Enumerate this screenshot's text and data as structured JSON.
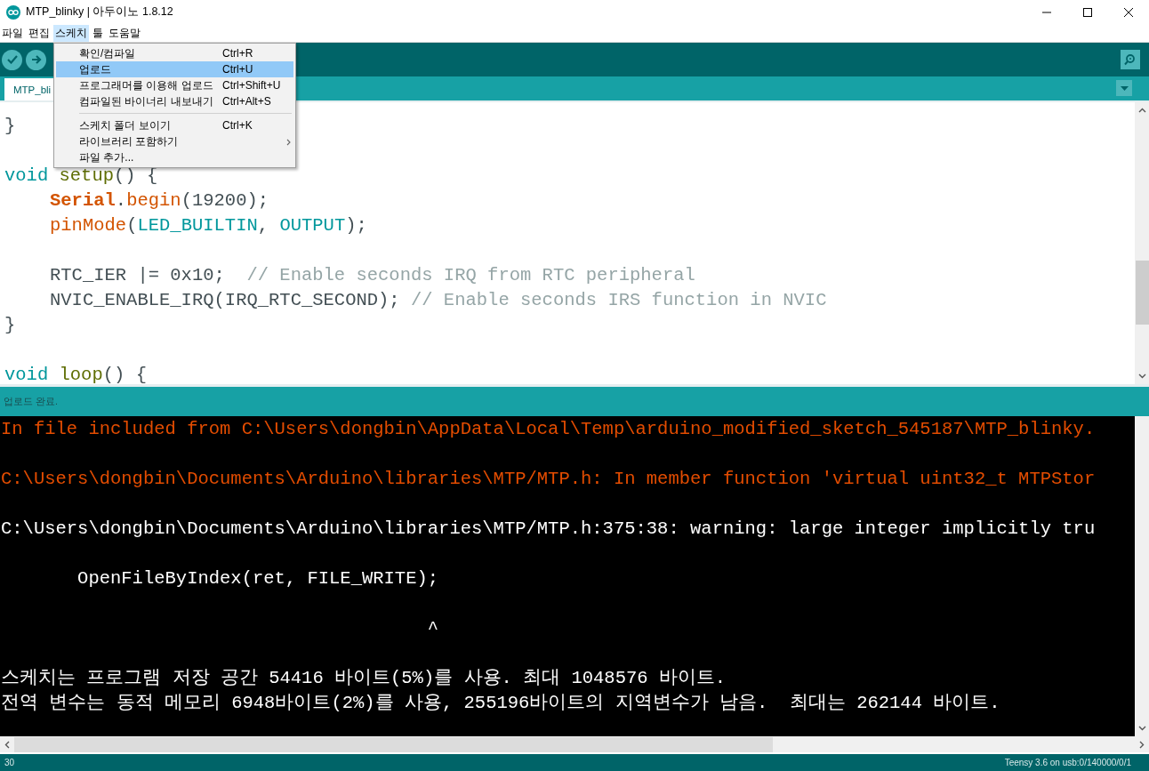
{
  "window": {
    "title": "MTP_blinky | 아두이노 1.8.12"
  },
  "menu_bar": [
    {
      "label": "파일",
      "selected": false
    },
    {
      "label": "편집",
      "selected": false
    },
    {
      "label": "스케치",
      "selected": true
    },
    {
      "label": "툴",
      "selected": false
    },
    {
      "label": "도움말",
      "selected": false
    }
  ],
  "menu": {
    "groups": [
      [
        {
          "kind": "item",
          "label": "확인/컴파일",
          "shortcut": "Ctrl+R",
          "selected": false
        },
        {
          "kind": "item",
          "label": "업로드",
          "shortcut": "Ctrl+U",
          "selected": true
        },
        {
          "kind": "item",
          "label": "프로그래머를 이용해 업로드",
          "shortcut": "Ctrl+Shift+U",
          "selected": false
        },
        {
          "kind": "item",
          "label": "컴파일된 바이너리 내보내기",
          "shortcut": "Ctrl+Alt+S",
          "selected": false
        }
      ],
      [
        {
          "kind": "item",
          "label": "스케치 폴더 보이기",
          "shortcut": "Ctrl+K",
          "selected": false
        },
        {
          "kind": "submenu",
          "label": "라이브러리 포함하기",
          "selected": false
        },
        {
          "kind": "item",
          "label": "파일 추가...",
          "selected": false
        }
      ]
    ]
  },
  "tabs": [
    {
      "label": "MTP_bli",
      "selected": true
    }
  ],
  "editor": {
    "lines": [
      {
        "kind": "code",
        "indented": false,
        "tokens": [
          {
            "kind": "plain",
            "text": "}"
          }
        ]
      },
      {
        "kind": "blank"
      },
      {
        "kind": "code",
        "indented": false,
        "tokens": [
          {
            "kind": "keyword",
            "text": "void "
          },
          {
            "kind": "function",
            "text": "setup"
          },
          {
            "kind": "plain",
            "text": "() {"
          }
        ]
      },
      {
        "kind": "code",
        "indented": true,
        "tokens": [
          {
            "kind": "class",
            "text": "Serial"
          },
          {
            "kind": "plain",
            "text": "."
          },
          {
            "kind": "method",
            "text": "begin"
          },
          {
            "kind": "plain",
            "text": "(19200);"
          }
        ]
      },
      {
        "kind": "code",
        "indented": true,
        "tokens": [
          {
            "kind": "method",
            "text": "pinMode"
          },
          {
            "kind": "plain",
            "text": "("
          },
          {
            "kind": "constant",
            "text": "LED_BUILTIN"
          },
          {
            "kind": "plain",
            "text": ", "
          },
          {
            "kind": "constant",
            "text": "OUTPUT"
          },
          {
            "kind": "plain",
            "text": ");"
          }
        ]
      },
      {
        "kind": "blank"
      },
      {
        "kind": "code",
        "indented": true,
        "tokens": [
          {
            "kind": "plain",
            "text": "RTC_IER |= 0x10;  "
          },
          {
            "kind": "comment",
            "text": "// Enable seconds IRQ from RTC peripheral"
          }
        ]
      },
      {
        "kind": "code",
        "indented": true,
        "tokens": [
          {
            "kind": "plain",
            "text": "NVIC_ENABLE_IRQ(IRQ_RTC_SECOND); "
          },
          {
            "kind": "comment",
            "text": "// Enable seconds IRS function in NVIC"
          }
        ]
      },
      {
        "kind": "code",
        "indented": false,
        "tokens": [
          {
            "kind": "plain",
            "text": "}"
          }
        ]
      },
      {
        "kind": "blank"
      },
      {
        "kind": "code",
        "indented": false,
        "tokens": [
          {
            "kind": "keyword",
            "text": "void "
          },
          {
            "kind": "function",
            "text": "loop"
          },
          {
            "kind": "plain",
            "text": "() {"
          }
        ]
      }
    ]
  },
  "status": {
    "message": "업로드 완료."
  },
  "console": {
    "lines": [
      {
        "kind": "error",
        "text": "In file included from C:\\Users\\dongbin\\AppData\\Local\\Temp\\arduino_modified_sketch_545187\\MTP_blinky."
      },
      {
        "kind": "blank"
      },
      {
        "kind": "error",
        "text": "C:\\Users\\dongbin\\Documents\\Arduino\\libraries\\MTP/MTP.h: In member function 'virtual uint32_t MTPStor"
      },
      {
        "kind": "blank"
      },
      {
        "kind": "output",
        "text": "C:\\Users\\dongbin\\Documents\\Arduino\\libraries\\MTP/MTP.h:375:38: warning: large integer implicitly tru"
      },
      {
        "kind": "blank"
      },
      {
        "kind": "output",
        "text": "       OpenFileByIndex(ret, FILE_WRITE);"
      },
      {
        "kind": "blank"
      },
      {
        "kind": "output",
        "text": "                                       ^"
      },
      {
        "kind": "blank"
      },
      {
        "kind": "output",
        "text": "스케치는 프로그램 저장 공간 54416 바이트(5%)를 사용. 최대 1048576 바이트."
      },
      {
        "kind": "output",
        "text": "전역 변수는 동적 메모리 6948바이트(2%)를 사용, 255196바이트의 지역변수가 남음.  최대는 262144 바이트."
      }
    ]
  },
  "footer": {
    "line": "30",
    "board": "Teensy 3.6 on usb:0/140000/0/1"
  }
}
